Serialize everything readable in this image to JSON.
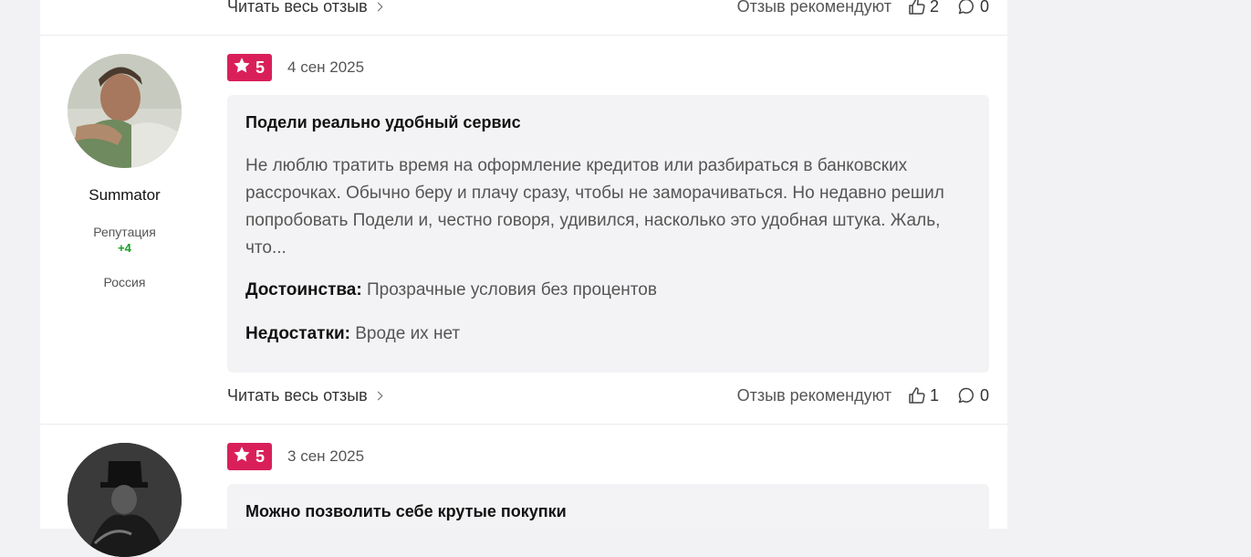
{
  "top_footer": {
    "read_more": "Читать весь отзыв",
    "recommend_label": "Отзыв рекомендуют",
    "likes": "2",
    "comments": "0"
  },
  "reviews": [
    {
      "author": "Summator",
      "reputation_label": "Репутация",
      "reputation_value": "+4",
      "country": "Россия",
      "rating": "5",
      "date": "4 сен 2025",
      "title": "Подели реально удобный сервис",
      "text": "Не люблю тратить время на оформление кредитов или разбираться в банковских рассрочках. Обычно беру и плачу сразу, чтобы не заморачиваться. Но недавно решил попробовать Подели и, честно говоря, удивился, насколько это удобная штука. Жаль, что...",
      "pros_label": "Достоинства:",
      "pros": "Прозрачные условия без процентов",
      "cons_label": "Недостатки:",
      "cons": "Вроде их нет",
      "read_more": "Читать весь отзыв",
      "recommend_label": "Отзыв рекомендуют",
      "likes": "1",
      "comments": "0"
    },
    {
      "rating": "5",
      "date": "3 сен 2025",
      "title": "Можно позволить себе крутые покупки"
    }
  ],
  "colors": {
    "rating_badge": "#d91f5a",
    "reputation_positive": "#1a9d28",
    "review_bg": "#f3f3f5"
  },
  "icons": [
    "chevron-right-icon",
    "thumbs-up-icon",
    "comment-icon",
    "star-icon"
  ]
}
